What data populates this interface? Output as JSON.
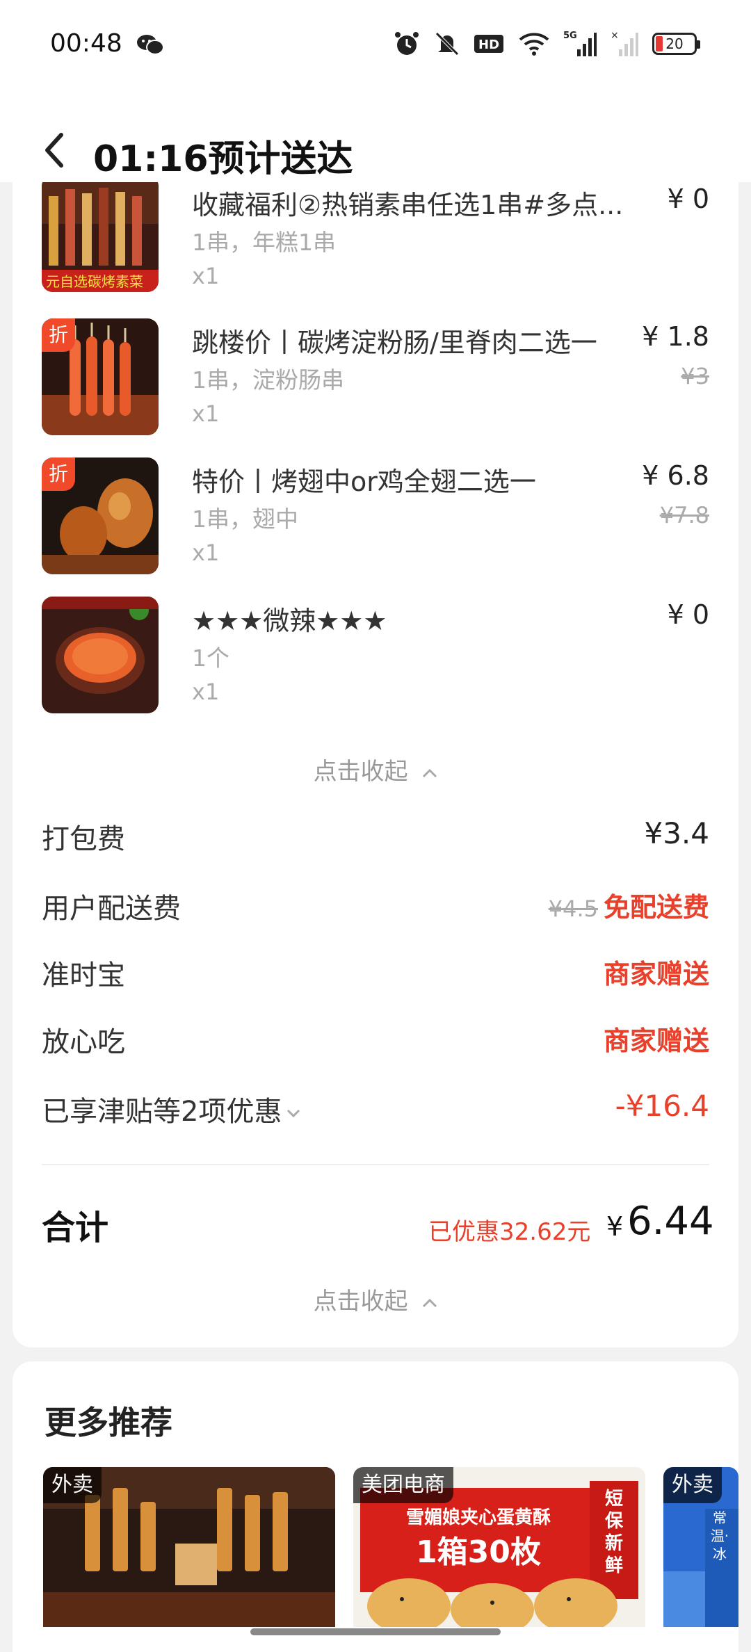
{
  "status_bar": {
    "time": "00:48",
    "battery": "20",
    "network": "5G",
    "icons": [
      "wechat-icon",
      "alarm-icon",
      "mute-icon",
      "hd-icon",
      "wifi-icon",
      "signal-icon"
    ]
  },
  "header": {
    "title": "01:16预计送达",
    "back_icon": "back-arrow-icon"
  },
  "items": [
    {
      "name": "收藏福利②热销素串任选1串#多点...",
      "spec": "1串，年糕1串",
      "qty": "x1",
      "price": "¥ 0",
      "original": "",
      "discount_badge": ""
    },
    {
      "name": "跳楼价丨碳烤淀粉肠/里脊肉二选一",
      "spec": "1串，淀粉肠串",
      "qty": "x1",
      "price": "¥ 1.8",
      "original": "¥3",
      "discount_badge": "折"
    },
    {
      "name": "特价丨烤翅中or鸡全翅二选一",
      "spec": "1串，翅中",
      "qty": "x1",
      "price": "¥ 6.8",
      "original": "¥7.8",
      "discount_badge": "折"
    },
    {
      "name": "★★★微辣★★★",
      "spec": "1个",
      "qty": "x1",
      "price": "¥ 0",
      "original": "",
      "discount_badge": ""
    }
  ],
  "collapse_label": "点击收起",
  "fees": {
    "packing": {
      "label": "打包费",
      "value": "¥3.4"
    },
    "delivery": {
      "label": "用户配送费",
      "original": "¥4.5",
      "value": "免配送费"
    },
    "ontime": {
      "label": "准时宝",
      "value": "商家赠送"
    },
    "safe": {
      "label": "放心吃",
      "value": "商家赠送"
    },
    "discount": {
      "label": "已享津贴等2项优惠",
      "value": "-¥16.4"
    }
  },
  "total": {
    "label": "合计",
    "saved": "已优惠32.62元",
    "currency": "¥",
    "amount": "6.44"
  },
  "recommend": {
    "title": "更多推荐",
    "items": [
      {
        "tag": "外卖",
        "image_text": ""
      },
      {
        "tag": "美团电商",
        "image_text": "1箱30枚",
        "image_sub": "雪媚娘夹心蛋黄酥",
        "image_side": "短保新鲜"
      },
      {
        "tag": "外卖",
        "image_text": "常温·冰"
      }
    ]
  },
  "colors": {
    "accent_red": "#e8402a",
    "discount_badge": "#f04a2a"
  }
}
